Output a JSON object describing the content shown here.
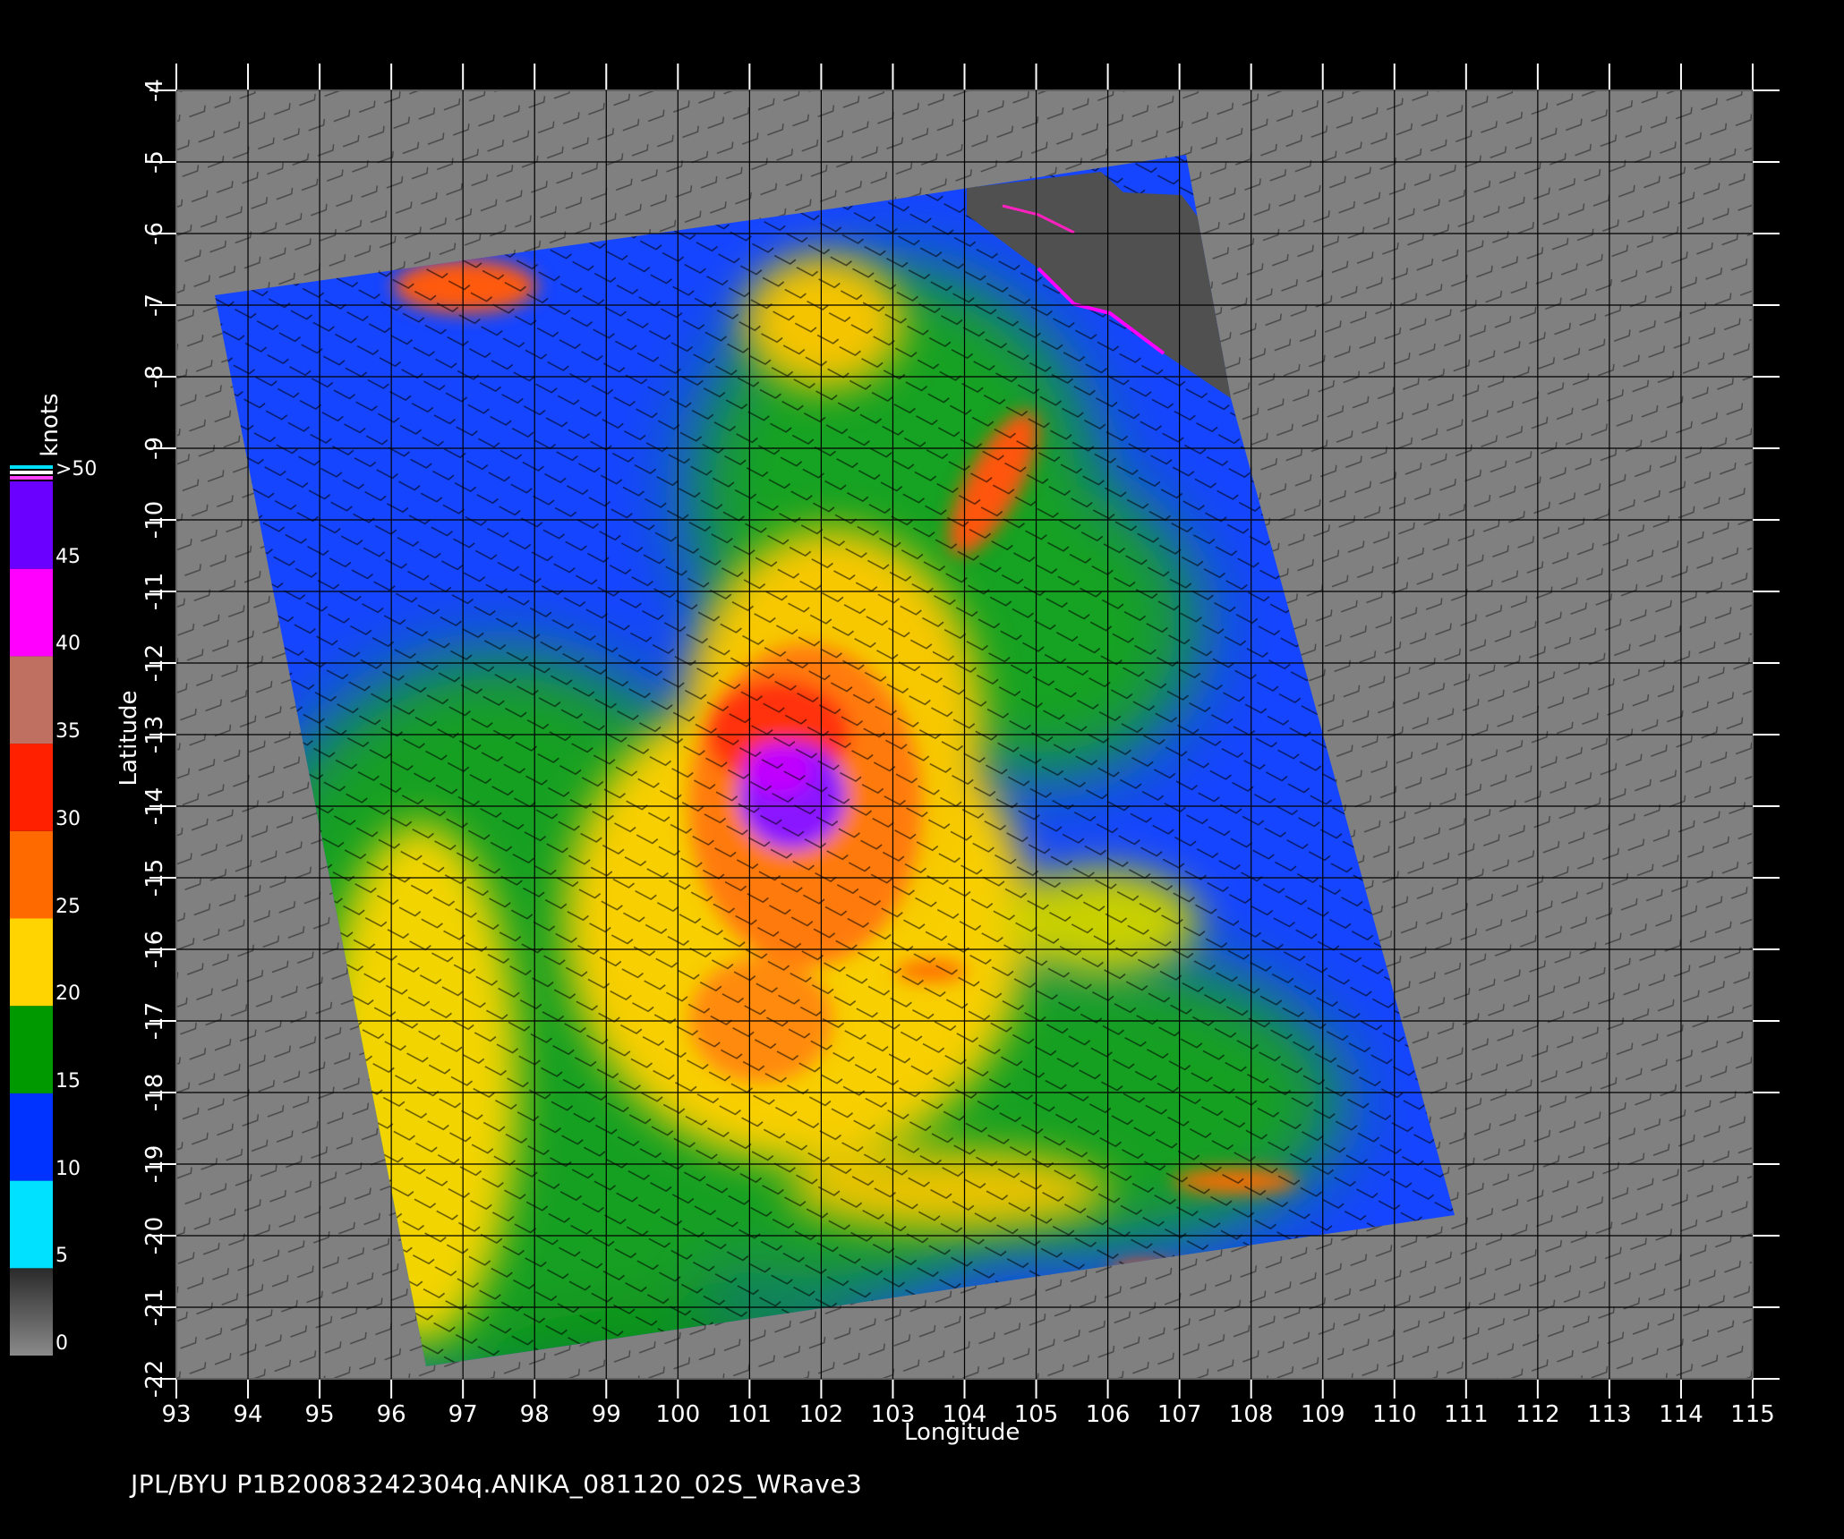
{
  "map": {
    "caption": "JPL/BYU  P1B20083242304q.ANIKA_081120_02S_WRave3",
    "xlabel": "Longitude",
    "ylabel": "Latitude",
    "lon_range": [
      93,
      115
    ],
    "lat_range": [
      -22,
      -4
    ],
    "lon_ticks": [
      "93",
      "94",
      "95",
      "96",
      "97",
      "98",
      "99",
      "100",
      "101",
      "102",
      "103",
      "104",
      "105",
      "106",
      "107",
      "108",
      "109",
      "110",
      "111",
      "112",
      "113",
      "114",
      "115"
    ],
    "lat_ticks": [
      "-4",
      "-5",
      "-6",
      "-7",
      "-8",
      "-9",
      "-10",
      "-11",
      "-12",
      "-13",
      "-14",
      "-15",
      "-16",
      "-17",
      "-18",
      "-19",
      "-20",
      "-21",
      "-22"
    ],
    "background_color": "#808080",
    "land_color": "#505050"
  },
  "colorbar": {
    "label": "knots",
    "ticks": [
      "0",
      "5",
      "10",
      "15",
      "20",
      "25",
      "30",
      "35",
      "40",
      "45",
      ">50"
    ],
    "colors": [
      "#7a7a7a",
      "#00e0ff",
      "#0033ff",
      "#009a00",
      "#ffd400",
      "#ff6a00",
      "#ff2000",
      "#c07060",
      "#ff00ff",
      "#6a00ff"
    ]
  }
}
